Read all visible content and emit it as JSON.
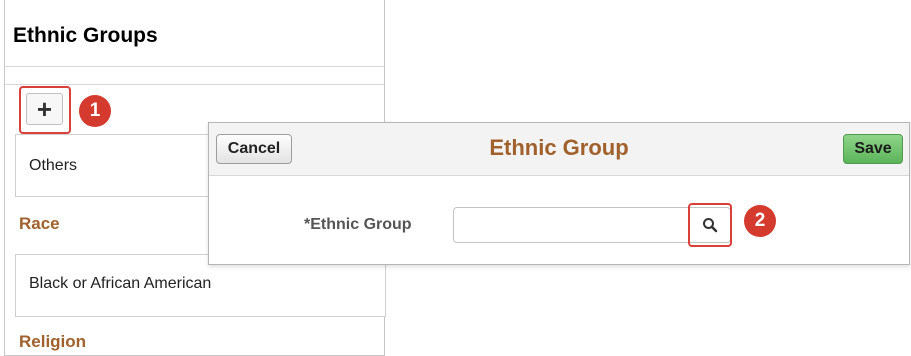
{
  "background_panel": {
    "title": "Ethnic Groups",
    "add_button_glyph": "+",
    "callout_add": "1",
    "rows": [
      {
        "section": "",
        "value": "Others"
      },
      {
        "section": "Race",
        "value": "Black or African American"
      },
      {
        "section": "Religion",
        "value": ""
      }
    ],
    "section_race": "Race",
    "row_others": "Others",
    "row_black": "Black or African American",
    "section_religion": "Religion"
  },
  "modal": {
    "title": "Ethnic Group",
    "cancel_label": "Cancel",
    "save_label": "Save",
    "field_label": "*Ethnic Group",
    "field_value": "",
    "callout_lookup": "2",
    "lookup_icon": "search-icon"
  },
  "colors": {
    "accent": "#a0612c",
    "callout": "#d43a2e",
    "highlight_border": "#d9403a",
    "save_green": "#5cb45a"
  }
}
